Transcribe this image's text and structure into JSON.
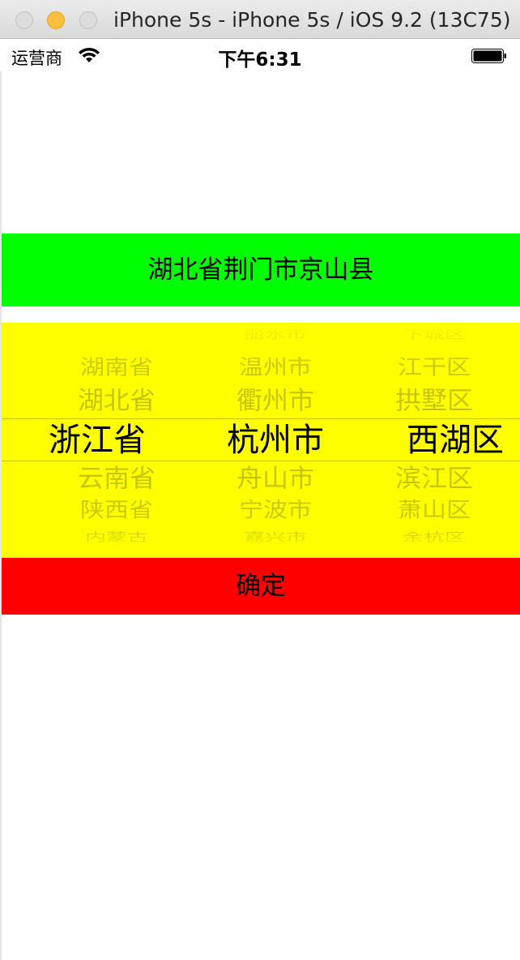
{
  "window": {
    "title": "iPhone 5s - iPhone 5s / iOS 9.2 (13C75)"
  },
  "status_bar": {
    "carrier": "运营商",
    "time": "下午6:31",
    "wifi_icon": "wifi-icon",
    "battery_icon": "battery-icon"
  },
  "address_label": {
    "text": "湖北省荆门市京山县",
    "background": "#00ff00"
  },
  "picker": {
    "background": "#ffff00",
    "columns": [
      {
        "name": "province",
        "selected": "浙江省",
        "items": [
          "",
          "湖南省",
          "湖北省",
          "浙江省",
          "云南省",
          "陕西省",
          "内蒙古"
        ]
      },
      {
        "name": "city",
        "selected": "杭州市",
        "items": [
          "丽水市",
          "温州市",
          "衢州市",
          "杭州市",
          "舟山市",
          "宁波市",
          "嘉兴市"
        ]
      },
      {
        "name": "district",
        "selected": "西湖区",
        "items": [
          "下城区",
          "江干区",
          "拱墅区",
          "西湖区",
          "滨江区",
          "萧山区",
          "余杭区"
        ]
      }
    ]
  },
  "confirm_button": {
    "label": "确定",
    "background": "#ff0000"
  }
}
